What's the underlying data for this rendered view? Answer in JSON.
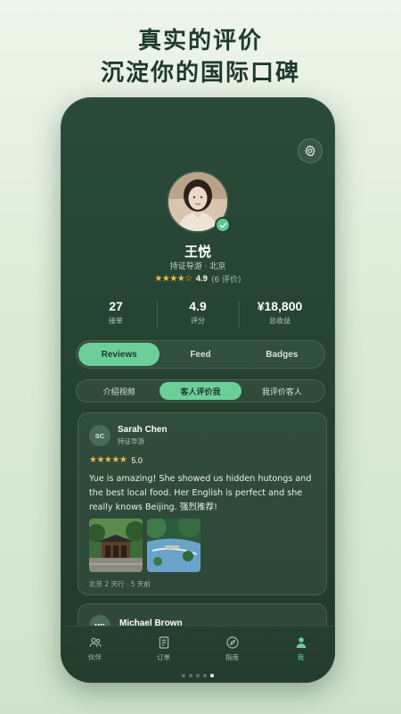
{
  "headline": {
    "line1": "真实的评价",
    "line2": "沉淀你的国际口碑"
  },
  "profile": {
    "name": "王悦",
    "subtitle": "持证导游 · 北京",
    "stars": "★★★★☆",
    "rating": "4.9",
    "review_count": "(6 评价)",
    "verified": true
  },
  "stats": [
    {
      "value": "27",
      "label": "接单"
    },
    {
      "value": "4.9",
      "label": "评分"
    },
    {
      "value": "¥18,800",
      "label": "总收益"
    }
  ],
  "tabs": [
    {
      "label": "Reviews",
      "active": true
    },
    {
      "label": "Feed",
      "active": false
    },
    {
      "label": "Badges",
      "active": false
    }
  ],
  "subtabs": [
    {
      "label": "介绍视频",
      "active": false
    },
    {
      "label": "客人评价我",
      "active": true
    },
    {
      "label": "我评价客人",
      "active": false
    }
  ],
  "reviews": [
    {
      "initials": "SC",
      "name": "Sarah Chen",
      "role": "持证导游",
      "stars": "★★★★★",
      "score": "5.0",
      "text": "Yue is amazing! She showed us hidden hutongs and the best local food. Her English is perfect and she really knows Beijing. 强烈推荐!",
      "meta": "北京 2 天行 · 5 天前"
    },
    {
      "initials": "MB",
      "name": "Michael Brown"
    }
  ],
  "nav": [
    {
      "label": "伙伴",
      "icon": "partners-icon",
      "active": false
    },
    {
      "label": "订单",
      "icon": "orders-icon",
      "active": false
    },
    {
      "label": "指南",
      "icon": "compass-icon",
      "active": false
    },
    {
      "label": "我",
      "icon": "profile-icon",
      "active": true
    }
  ],
  "page_dots": {
    "count": 5,
    "active_index": 4
  },
  "colors": {
    "accent": "#6ccf9a",
    "star": "#f2b844",
    "panel": "#24402f"
  }
}
